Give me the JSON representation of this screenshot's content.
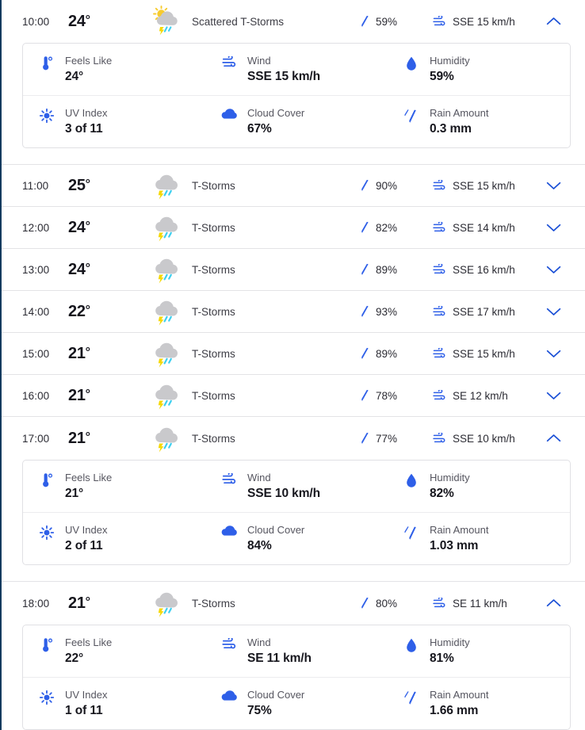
{
  "colors": {
    "accent_blue": "#2e5fe8",
    "chevron_blue": "#1a4fd6",
    "left_border": "#123a5e",
    "divider": "#e3e3e6",
    "card_border": "#e0e0e4",
    "cloud_gray": "#c9c9cc",
    "sun_yellow": "#f7cb2e",
    "bolt_yellow": "#f5d800",
    "rain_cyan": "#3fd0f0"
  },
  "detail_labels": {
    "feels_like": "Feels Like",
    "wind": "Wind",
    "humidity": "Humidity",
    "uv_index": "UV Index",
    "cloud_cover": "Cloud Cover",
    "rain_amount": "Rain Amount"
  },
  "icon_names": {
    "feels_like": "thermometer-icon",
    "wind": "wind-icon",
    "humidity": "water-drop-icon",
    "uv_index": "sun-uv-icon",
    "cloud_cover": "cloud-icon",
    "rain_amount": "rain-streaks-icon",
    "precip": "raindrop-icon",
    "row_wind": "wind-icon",
    "expand": "chevron-down-icon",
    "collapse": "chevron-up-icon"
  },
  "hours": [
    {
      "time": "10:00",
      "temp": "24",
      "degree": "°",
      "condition": "Scattered T-Storms",
      "icon": "scattered-thunderstorms-icon",
      "precip": "59%",
      "wind": "SSE 15 km/h",
      "expanded": true,
      "details": {
        "feels_like": "24°",
        "wind": "SSE 15 km/h",
        "humidity": "59%",
        "uv_index": "3 of 11",
        "cloud_cover": "67%",
        "rain_amount": "0.3 mm"
      }
    },
    {
      "time": "11:00",
      "temp": "25",
      "degree": "°",
      "condition": "T-Storms",
      "icon": "thunderstorms-icon",
      "precip": "90%",
      "wind": "SSE 15 km/h",
      "expanded": false,
      "details": null
    },
    {
      "time": "12:00",
      "temp": "24",
      "degree": "°",
      "condition": "T-Storms",
      "icon": "thunderstorms-icon",
      "precip": "82%",
      "wind": "SSE 14 km/h",
      "expanded": false,
      "details": null
    },
    {
      "time": "13:00",
      "temp": "24",
      "degree": "°",
      "condition": "T-Storms",
      "icon": "thunderstorms-icon",
      "precip": "89%",
      "wind": "SSE 16 km/h",
      "expanded": false,
      "details": null
    },
    {
      "time": "14:00",
      "temp": "22",
      "degree": "°",
      "condition": "T-Storms",
      "icon": "thunderstorms-icon",
      "precip": "93%",
      "wind": "SSE 17 km/h",
      "expanded": false,
      "details": null
    },
    {
      "time": "15:00",
      "temp": "21",
      "degree": "°",
      "condition": "T-Storms",
      "icon": "thunderstorms-icon",
      "precip": "89%",
      "wind": "SSE 15 km/h",
      "expanded": false,
      "details": null
    },
    {
      "time": "16:00",
      "temp": "21",
      "degree": "°",
      "condition": "T-Storms",
      "icon": "thunderstorms-icon",
      "precip": "78%",
      "wind": "SE 12 km/h",
      "expanded": false,
      "details": null
    },
    {
      "time": "17:00",
      "temp": "21",
      "degree": "°",
      "condition": "T-Storms",
      "icon": "thunderstorms-icon",
      "precip": "77%",
      "wind": "SSE 10 km/h",
      "expanded": true,
      "details": {
        "feels_like": "21°",
        "wind": "SSE 10 km/h",
        "humidity": "82%",
        "uv_index": "2 of 11",
        "cloud_cover": "84%",
        "rain_amount": "1.03 mm"
      }
    },
    {
      "time": "18:00",
      "temp": "21",
      "degree": "°",
      "condition": "T-Storms",
      "icon": "thunderstorms-icon",
      "precip": "80%",
      "wind": "SE 11 km/h",
      "expanded": true,
      "details": {
        "feels_like": "22°",
        "wind": "SE 11 km/h",
        "humidity": "81%",
        "uv_index": "1 of 11",
        "cloud_cover": "75%",
        "rain_amount": "1.66 mm"
      }
    }
  ]
}
